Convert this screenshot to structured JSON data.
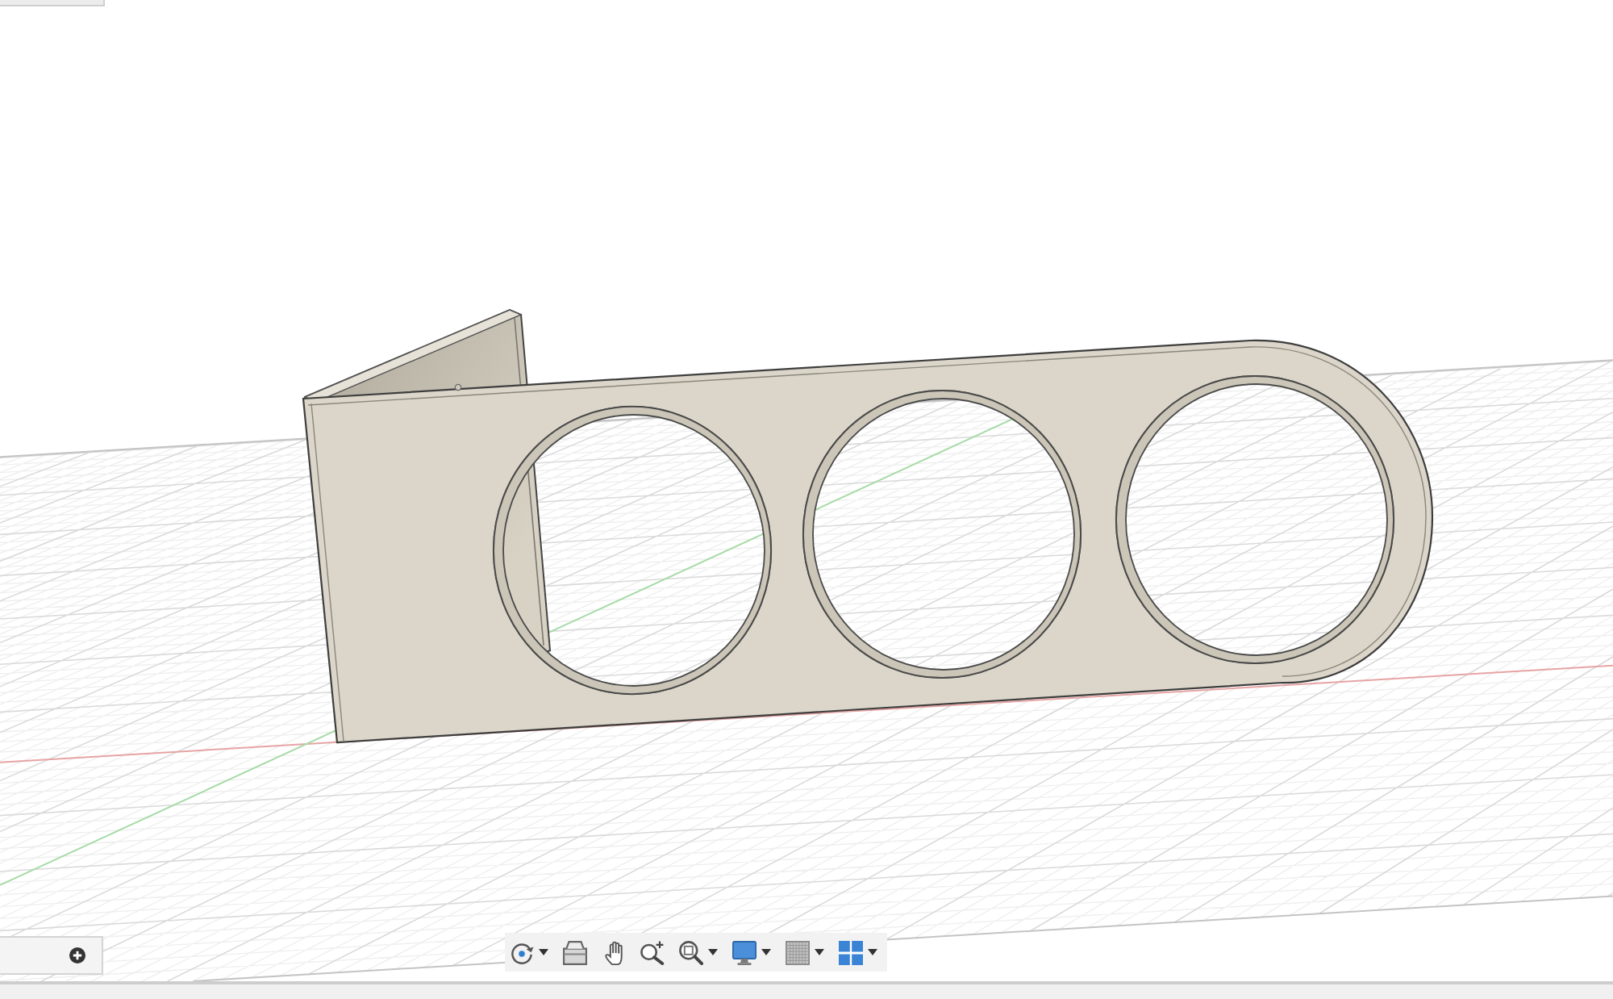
{
  "navigation_toolbar": {
    "tools": [
      {
        "kind": "orbit",
        "dropdown": true
      },
      {
        "kind": "look_at",
        "dropdown": false
      },
      {
        "kind": "pan",
        "dropdown": false
      },
      {
        "kind": "zoom",
        "dropdown": false
      },
      {
        "kind": "fit",
        "dropdown": true
      },
      {
        "kind": "display",
        "dropdown": true
      },
      {
        "kind": "grid",
        "dropdown": true
      },
      {
        "kind": "viewports",
        "dropdown": true
      }
    ]
  },
  "bottom_panel": {
    "buttons": [
      {
        "kind": "add"
      }
    ]
  }
}
